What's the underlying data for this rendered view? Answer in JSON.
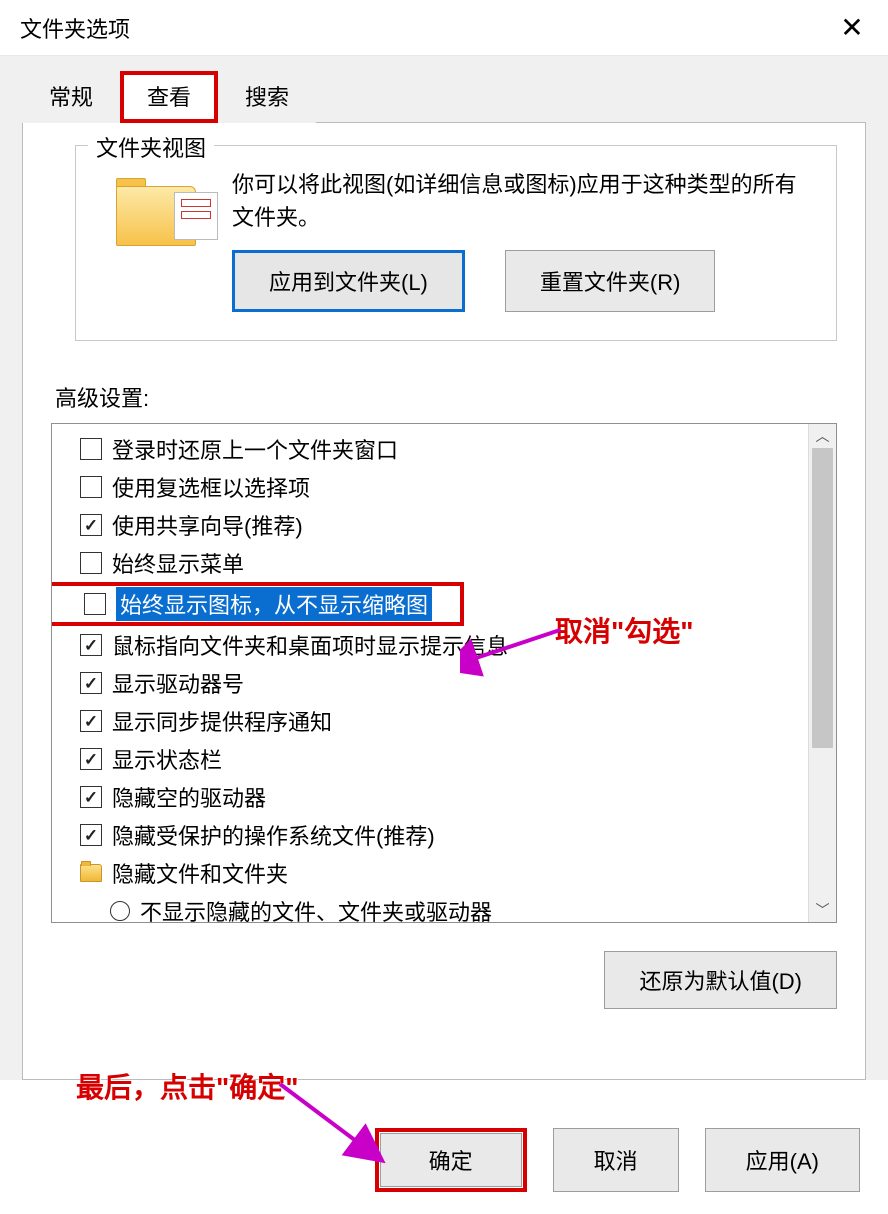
{
  "window": {
    "title": "文件夹选项"
  },
  "tabs": {
    "general": "常规",
    "view": "查看",
    "search": "搜索"
  },
  "folderViews": {
    "legend": "文件夹视图",
    "desc": "你可以将此视图(如详细信息或图标)应用于这种类型的所有文件夹。",
    "applyBtn": "应用到文件夹(L)",
    "resetBtn": "重置文件夹(R)"
  },
  "advanced": {
    "label": "高级设置:",
    "items": [
      {
        "type": "checkbox",
        "checked": false,
        "text": "登录时还原上一个文件夹窗口"
      },
      {
        "type": "checkbox",
        "checked": false,
        "text": "使用复选框以选择项"
      },
      {
        "type": "checkbox",
        "checked": true,
        "text": "使用共享向导(推荐)"
      },
      {
        "type": "checkbox",
        "checked": false,
        "text": "始终显示菜单"
      },
      {
        "type": "checkbox",
        "checked": false,
        "text": "始终显示图标，从不显示缩略图",
        "selected": true,
        "redframe": true
      },
      {
        "type": "checkbox",
        "checked": true,
        "text": "鼠标指向文件夹和桌面项时显示提示信息"
      },
      {
        "type": "checkbox",
        "checked": true,
        "text": "显示驱动器号"
      },
      {
        "type": "checkbox",
        "checked": true,
        "text": "显示同步提供程序通知"
      },
      {
        "type": "checkbox",
        "checked": true,
        "text": "显示状态栏"
      },
      {
        "type": "checkbox",
        "checked": true,
        "text": "隐藏空的驱动器"
      },
      {
        "type": "checkbox",
        "checked": true,
        "text": "隐藏受保护的操作系统文件(推荐)"
      },
      {
        "type": "folder",
        "text": "隐藏文件和文件夹"
      },
      {
        "type": "radio",
        "checked": false,
        "text": "不显示隐藏的文件、文件夹或驱动器"
      }
    ]
  },
  "restoreDefaults": "还原为默认值(D)",
  "buttons": {
    "ok": "确定",
    "cancel": "取消",
    "apply": "应用(A)"
  },
  "annotations": {
    "uncheck": "取消\"勾选\"",
    "finally": "最后，点击\"确定\""
  }
}
